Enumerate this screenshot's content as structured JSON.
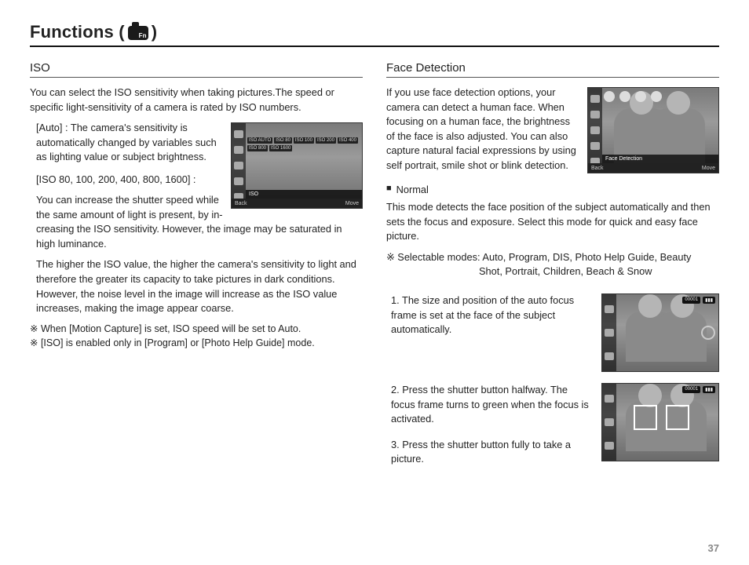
{
  "page_title_prefix": "Functions (",
  "page_title_suffix": ")",
  "page_number": "37",
  "iso": {
    "heading": "ISO",
    "intro": "You can select the ISO sensitivity when taking pictures.The speed or specific light-sensitivity of a camera is rated by ISO numbers.",
    "auto_label": "[Auto] : ",
    "auto_text": "The camera's sensitivity is automatically changed by variables such as lighting value or subject brightness.",
    "range_label": "[ISO 80, 100, 200, 400, 800, 1600] :",
    "range_text_1": "You can increase the shutter speed while the same amount of light is present, by in-",
    "range_text_2": "creasing the ISO sensitivity. However, the image may be saturated in high luminance.",
    "range_text_3": "The higher the ISO value, the higher the camera's sensitivity to light and therefore the greater its capacity to take pictures in dark conditions. However, the noise level in the image will increase as the ISO value increases, making the image appear coarse.",
    "note1": "※ When [Motion Capture] is set, ISO speed will be set to Auto.",
    "note2": "※ [ISO] is enabled only in [Program] or [Photo Help Guide] mode.",
    "lcd_menu": "ISO",
    "lcd_back": "Back",
    "lcd_move": "Move"
  },
  "fd": {
    "heading": "Face Detection",
    "intro": "If you use face detection options, your camera can detect a human face. When focusing on a human face, the brightness of the face is also adjusted. You can also capture natural facial expressions by using self portrait, smile shot or blink detection.",
    "lcd_menu": "Face Detection",
    "lcd_back": "Back",
    "lcd_move": "Move",
    "mode_label": "Normal",
    "mode_text": "This mode detects the face position of the subject automatically and then sets the focus and exposure. Select this mode for quick and easy face picture.",
    "selectable_prefix": "※ Selectable modes: ",
    "selectable_1": "Auto, Program, DIS, Photo Help Guide, Beauty",
    "selectable_2": "Shot, Portrait, Children, Beach & Snow",
    "step1": "1. The size and position of the auto focus frame is set at the face of the subject automatically.",
    "step2": "2. Press the shutter button halfway. The focus frame turns to green when the focus is activated.",
    "step3": "3. Press the shutter button fully to take a picture.",
    "osd_counter": "00001"
  }
}
